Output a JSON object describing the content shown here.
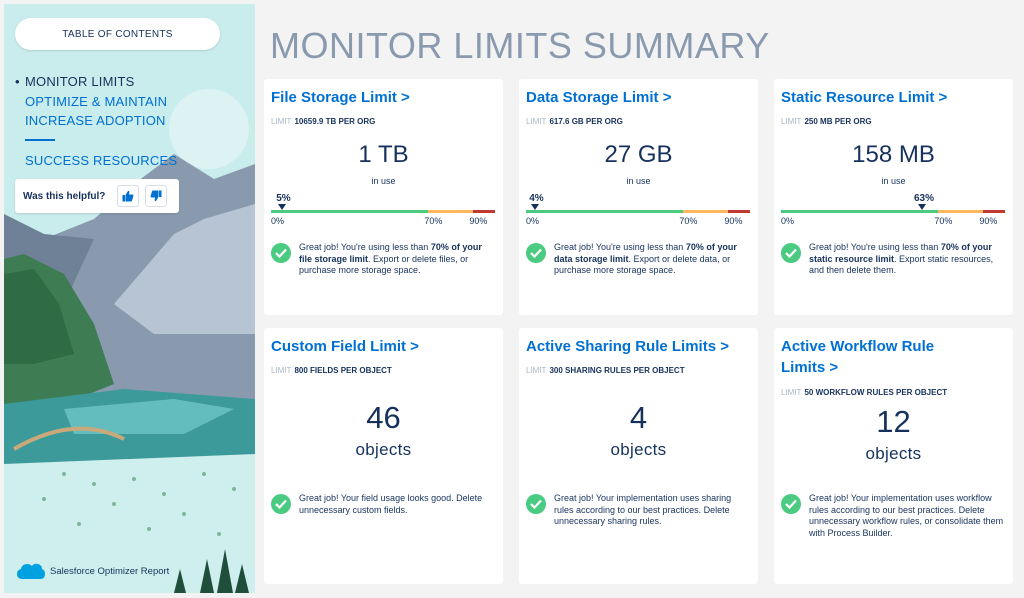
{
  "sidebar": {
    "toc_label": "TABLE OF CONTENTS",
    "nav": [
      {
        "label": "MONITOR LIMITS",
        "active": true
      },
      {
        "label": "OPTIMIZE & MAINTAIN",
        "active": false
      },
      {
        "label": "INCREASE ADOPTION",
        "active": false
      },
      {
        "label": "SUCCESS RESOURCES",
        "active": false
      }
    ],
    "helpful_label": "Was this helpful?",
    "brand_label": "Salesforce Optimizer Report"
  },
  "page": {
    "title": "MONITOR LIMITS SUMMARY"
  },
  "limit_prefix": "LIMIT",
  "cards": [
    {
      "title": "File Storage Limit >",
      "limit": "10659.9 TB PER ORG",
      "value": "1 TB",
      "value_caption": "in use",
      "usage_pct": 5,
      "usage_label": "5%",
      "ticks": [
        "0%",
        "70%",
        "90%"
      ],
      "msg_pre": "Great job! You're using less than ",
      "msg_bold": "70% of your file storage limit",
      "msg_post": ". Export or delete files, or purchase more storage space."
    },
    {
      "title": "Data Storage Limit >",
      "limit": "617.6 GB PER ORG",
      "value": "27 GB",
      "value_caption": "in use",
      "usage_pct": 4,
      "usage_label": "4%",
      "ticks": [
        "0%",
        "70%",
        "90%"
      ],
      "msg_pre": "Great job! You're using less than ",
      "msg_bold": "70% of your data storage limit",
      "msg_post": ". Export or delete data, or purchase more storage space."
    },
    {
      "title": "Static Resource Limit >",
      "limit": "250 MB PER ORG",
      "value": "158 MB",
      "value_caption": "in use",
      "usage_pct": 63,
      "usage_label": "63%",
      "ticks": [
        "0%",
        "70%",
        "90%"
      ],
      "msg_pre": "Great job! You're using less than ",
      "msg_bold": "70% of your static resource limit",
      "msg_post": ". Export static resources, and then delete them."
    },
    {
      "title": "Custom Field Limit >",
      "limit": "800 FIELDS PER OBJECT",
      "value": "46",
      "value_caption": "objects",
      "msg": "Great job! Your field usage looks good. Delete unnecessary custom fields."
    },
    {
      "title": "Active Sharing Rule Limits >",
      "limit": "300 SHARING RULES PER OBJECT",
      "value": "4",
      "value_caption": "objects",
      "msg": "Great job! Your implementation uses sharing rules according to our best practices. Delete unnecessary sharing rules."
    },
    {
      "title": "Active Workflow Rule Limits >",
      "limit": "50 WORKFLOW RULES PER OBJECT",
      "value": "12",
      "value_caption": "objects",
      "msg": "Great job! Your implementation uses workflow rules according to our best practices. Delete unnecessary workflow rules, or consolidate them with Process Builder."
    }
  ],
  "colors": {
    "link": "#0070d2",
    "text": "#16325c",
    "gauge_green": "#4bca81",
    "gauge_orange": "#ffb75d",
    "gauge_red": "#c23934"
  }
}
